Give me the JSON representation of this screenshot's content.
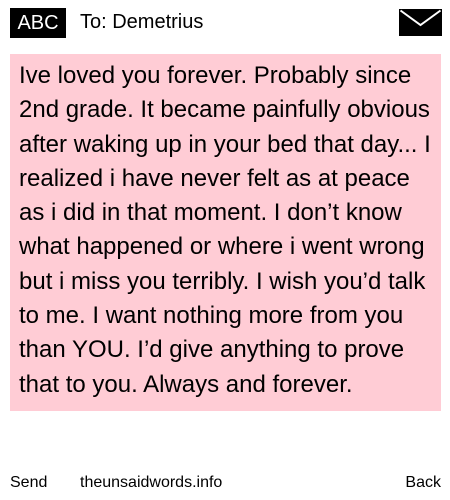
{
  "header": {
    "mode_badge": "ABC",
    "recipient": "To: Demetrius",
    "envelope_icon": "envelope-icon"
  },
  "message": {
    "body": "Ive loved you forever. Probably since 2nd grade. It became painfully obvious after waking up in your bed that day... I realized i have never felt as at peace as i did in that moment. I don’t know what happened or where i went wrong but i miss you terribly. I wish you’d talk to me. I want nothing more from you than YOU. I’d give anything to prove that to you. Always and forever."
  },
  "footer": {
    "send_label": "Send",
    "credit": "theunsaidwords.info",
    "back_label": "Back"
  },
  "colors": {
    "message_background": "#ffccd5",
    "badge_background": "#000000"
  }
}
